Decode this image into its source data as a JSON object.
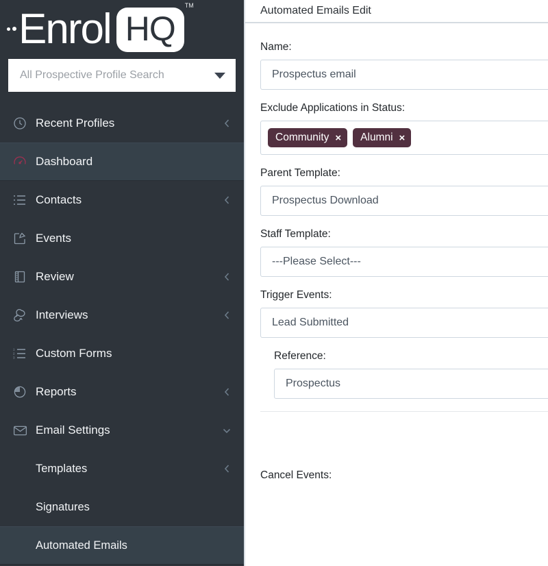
{
  "brand": {
    "name_word": "Enrol",
    "badge_text": "HQ",
    "trademark": "TM",
    "sidebar_bg": "#2e343b",
    "active_bg": "#36414a",
    "accent_red": "#a03050"
  },
  "search": {
    "placeholder": "All Prospective Profile Search",
    "caret_icon": "chevron-down-icon"
  },
  "sidebar": {
    "items": [
      {
        "label": "Recent Profiles",
        "icon": "clock-icon",
        "chevron": "chevron-left-icon",
        "active": false,
        "sub": false
      },
      {
        "label": "Dashboard",
        "icon": "speedometer-icon",
        "chevron": "",
        "active": true,
        "sub": false
      },
      {
        "label": "Contacts",
        "icon": "list-icon",
        "chevron": "chevron-left-icon",
        "active": false,
        "sub": false
      },
      {
        "label": "Events",
        "icon": "pencil-square-icon",
        "chevron": "",
        "active": false,
        "sub": false
      },
      {
        "label": "Review",
        "icon": "book-icon",
        "chevron": "chevron-left-icon",
        "active": false,
        "sub": false
      },
      {
        "label": "Interviews",
        "icon": "chat-bubbles-icon",
        "chevron": "chevron-left-icon",
        "active": false,
        "sub": false
      },
      {
        "label": "Custom Forms",
        "icon": "numbered-list-icon",
        "chevron": "",
        "active": false,
        "sub": false
      },
      {
        "label": "Reports",
        "icon": "pie-chart-icon",
        "chevron": "chevron-left-icon",
        "active": false,
        "sub": false
      },
      {
        "label": "Email Settings",
        "icon": "envelope-icon",
        "chevron": "chevron-down-icon",
        "active": false,
        "sub": false
      },
      {
        "label": "Templates",
        "icon": "",
        "chevron": "chevron-left-icon",
        "active": false,
        "sub": true
      },
      {
        "label": "Signatures",
        "icon": "",
        "chevron": "",
        "active": false,
        "sub": true
      },
      {
        "label": "Automated Emails",
        "icon": "",
        "chevron": "",
        "active": true,
        "sub": true
      }
    ]
  },
  "main": {
    "header_title": "Automated Emails Edit",
    "fields": {
      "name": {
        "label": "Name:",
        "value": "Prospectus email"
      },
      "exclude_status": {
        "label": "Exclude Applications in Status:",
        "tags": [
          "Community",
          "Alumni"
        ],
        "tag_remove_glyph": "×"
      },
      "parent_template": {
        "label": "Parent Template:",
        "value": "Prospectus Download"
      },
      "staff_template": {
        "label": "Staff Template:",
        "value": "---Please Select---"
      },
      "trigger_events": {
        "label": "Trigger Events:",
        "value": "Lead Submitted"
      },
      "reference": {
        "label": "Reference:",
        "value": "Prospectus"
      },
      "cancel_events": {
        "label": "Cancel Events:"
      }
    }
  }
}
